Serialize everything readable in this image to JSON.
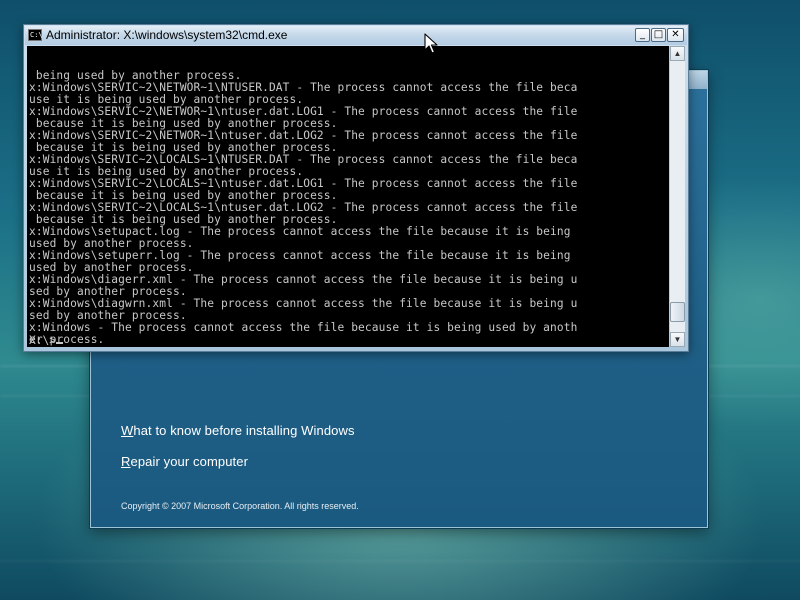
{
  "setup": {
    "links": [
      {
        "accel": "W",
        "rest": "hat to know before installing Windows"
      },
      {
        "accel": "R",
        "rest": "epair your computer"
      }
    ],
    "copyright": "Copyright © 2007 Microsoft Corporation. All rights reserved."
  },
  "cmd": {
    "icon_text": "C:\\",
    "title": "Administrator: X:\\windows\\system32\\cmd.exe",
    "buttons": {
      "minimize": "_",
      "maximize": "□",
      "close": "✕"
    },
    "output": " being used by another process.\nx:Windows\\SERVIC~2\\NETWOR~1\\NTUSER.DAT - The process cannot access the file beca\nuse it is being used by another process.\nx:Windows\\SERVIC~2\\NETWOR~1\\ntuser.dat.LOG1 - The process cannot access the file\n because it is being used by another process.\nx:Windows\\SERVIC~2\\NETWOR~1\\ntuser.dat.LOG2 - The process cannot access the file\n because it is being used by another process.\nx:Windows\\SERVIC~2\\LOCALS~1\\NTUSER.DAT - The process cannot access the file beca\nuse it is being used by another process.\nx:Windows\\SERVIC~2\\LOCALS~1\\ntuser.dat.LOG1 - The process cannot access the file\n because it is being used by another process.\nx:Windows\\SERVIC~2\\LOCALS~1\\ntuser.dat.LOG2 - The process cannot access the file\n because it is being used by another process.\nx:Windows\\setupact.log - The process cannot access the file because it is being\nused by another process.\nx:Windows\\setuperr.log - The process cannot access the file because it is being\nused by another process.\nx:Windows\\diagerr.xml - The process cannot access the file because it is being u\nsed by another process.\nx:Windows\\diagwrn.xml - The process cannot access the file because it is being u\nsed by another process.\nx:Windows - The process cannot access the file because it is being used by anoth\ner process.",
    "prompt": "X:\\>",
    "scroll": {
      "up": "▲",
      "down": "▼"
    }
  }
}
